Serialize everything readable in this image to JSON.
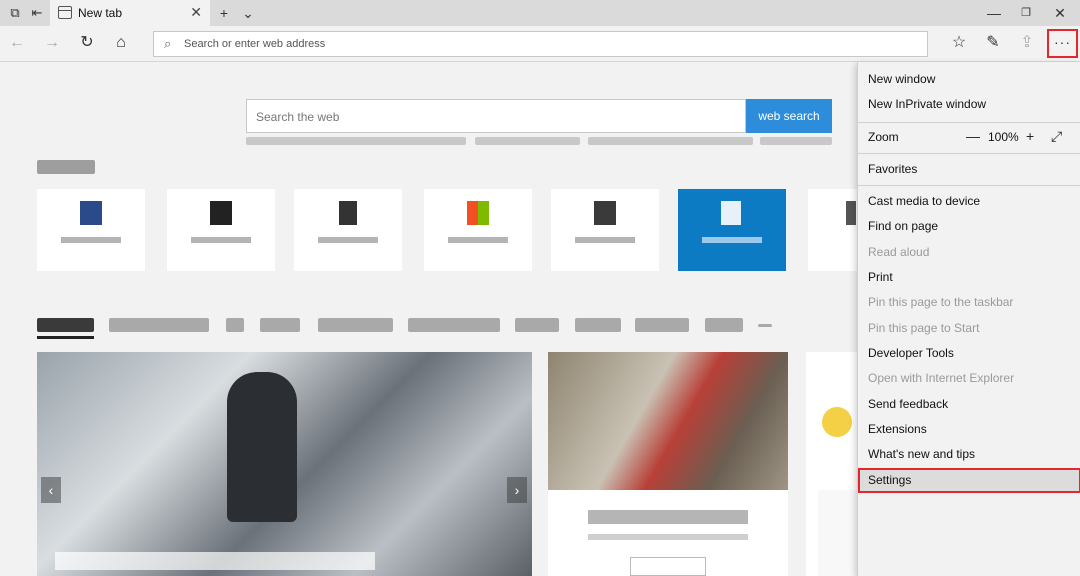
{
  "tab": {
    "title": "New tab"
  },
  "address": {
    "placeholder": "Search or enter web address"
  },
  "search": {
    "placeholder": "Search the web",
    "button": "web search"
  },
  "menu": {
    "items": [
      {
        "label": "New window",
        "enabled": true
      },
      {
        "label": "New InPrivate window",
        "enabled": true
      },
      {
        "label": "Zoom",
        "enabled": true,
        "value": "100%"
      },
      {
        "label": "Favorites",
        "enabled": true
      },
      {
        "label": "Cast media to device",
        "enabled": true
      },
      {
        "label": "Find on page",
        "enabled": true
      },
      {
        "label": "Read aloud",
        "enabled": false
      },
      {
        "label": "Print",
        "enabled": true
      },
      {
        "label": "Pin this page to the taskbar",
        "enabled": false
      },
      {
        "label": "Pin this page to Start",
        "enabled": false
      },
      {
        "label": "Developer Tools",
        "enabled": true
      },
      {
        "label": "Open with Internet Explorer",
        "enabled": false
      },
      {
        "label": "Send feedback",
        "enabled": true
      },
      {
        "label": "Extensions",
        "enabled": true
      },
      {
        "label": "What's new and tips",
        "enabled": true
      },
      {
        "label": "Settings",
        "enabled": true,
        "highlighted": true
      }
    ]
  },
  "icons": {
    "titlebar": [
      "tab-manager-icon",
      "set-tabs-aside-icon"
    ],
    "nav": [
      "back-icon",
      "forward-icon",
      "refresh-icon",
      "home-icon"
    ],
    "toolbar": [
      "favorites-star-icon",
      "pen-icon",
      "share-icon",
      "more-icon"
    ]
  },
  "colors": {
    "accent": "#2d8ddb",
    "highlight_border": "#e0282e",
    "active_tile": "#0d7bc4"
  }
}
